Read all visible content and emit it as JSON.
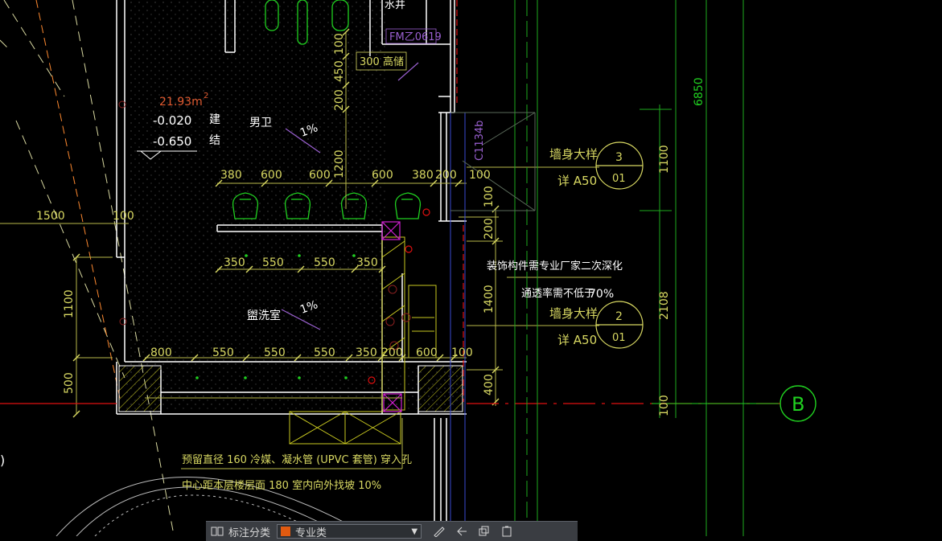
{
  "drawing": {
    "top_label": "水井",
    "door_tag": "FM乙0619",
    "window_tag": "C1134b",
    "room_area": "21.93m",
    "room_area_unit": "2",
    "level_arch": "-0.020",
    "level_struct": "-0.650",
    "level_arch_mark": "建",
    "level_struct_mark": "结",
    "room_men": "男卫",
    "room_wash": "盥洗室",
    "slope_1": "1%",
    "slope_2": "1%",
    "riser_note": "300 高储",
    "dims_top": [
      "380",
      "600",
      "600",
      "600",
      "380",
      "200",
      "100"
    ],
    "dims_mid": [
      "350",
      "550",
      "550",
      "350"
    ],
    "dims_bottom": [
      "800",
      "550",
      "550",
      "550",
      "350",
      "200",
      "600",
      "100"
    ],
    "dims_left": [
      "1500",
      "100",
      "1100",
      "500"
    ],
    "dims_vertical": [
      "100",
      "450",
      "200",
      "1200",
      "100",
      "200",
      "1400",
      "400",
      "1100",
      "2108",
      "100",
      "6850"
    ],
    "callout_1_title": "墙身大样",
    "callout_1_ref": "详 A50",
    "callout_1_num": "3",
    "callout_1_sheet": "01",
    "callout_2_title": "墙身大样",
    "callout_2_ref": "详 A50",
    "callout_2_num": "2",
    "callout_2_sheet": "01",
    "note_decor": "装饰构件需专业厂家二次深化",
    "note_vent": "通透率需不低于",
    "note_vent_pct": "70%",
    "note_pipe_1": "预留直径 160 冷媒、凝水管 (UPVC 套管) 穿入孔",
    "note_pipe_2": "中心距本层楼层面 180 室内向外找坡 10%",
    "grid_axis": "B",
    "left_edge_mark": ")"
  },
  "toolbar": {
    "annot_label": "标注分类",
    "layer_name": "专业类"
  },
  "colors": {
    "background": "#000000",
    "wall": "#ffffff",
    "dim": "#d8d862",
    "green": "#20d020",
    "red": "#e01010",
    "magenta": "#d020d0",
    "purple": "#9a60d0",
    "cyan": "#30d0d0",
    "layer_swatch": "#e05a10"
  }
}
